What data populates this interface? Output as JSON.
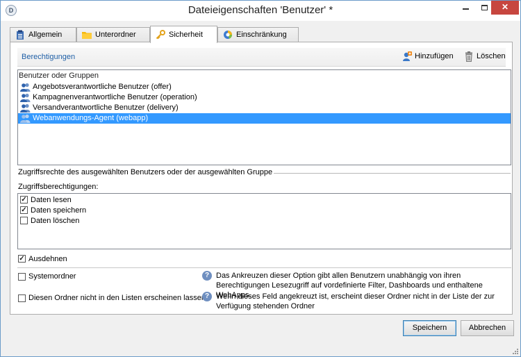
{
  "window": {
    "title": "Dateieigenschaften 'Benutzer' *",
    "app_icon": "D",
    "controls": {
      "minimize": "minimize-icon",
      "maximize": "maximize-icon",
      "close": "✕"
    }
  },
  "tabs": [
    {
      "label": "Allgemein",
      "icon": "clipboard-icon",
      "active": false
    },
    {
      "label": "Unterordner",
      "icon": "folder-icon",
      "active": false
    },
    {
      "label": "Sicherheit",
      "icon": "key-icon",
      "active": true
    },
    {
      "label": "Einschränkung",
      "icon": "pie-icon",
      "active": false
    }
  ],
  "permissions": {
    "title": "Berechtigungen",
    "add_label": "Hinzufügen",
    "delete_label": "Löschen"
  },
  "user_list": {
    "header": "Benutzer oder Gruppen",
    "items": [
      {
        "label": "Angebotsverantwortliche Benutzer (offer)",
        "selected": false
      },
      {
        "label": "Kampagnenverantwortliche Benutzer (operation)",
        "selected": false
      },
      {
        "label": "Versandverantwortliche Benutzer (delivery)",
        "selected": false
      },
      {
        "label": "Webanwendungs-Agent (webapp)",
        "selected": true
      }
    ]
  },
  "rights": {
    "section_label": "Zugriffsrechte des ausgewählten Benutzers oder der ausgewählten Gruppe",
    "list_label": "Zugriffsberechtigungen:",
    "items": [
      {
        "label": "Daten lesen",
        "checked": true
      },
      {
        "label": "Daten speichern",
        "checked": true
      },
      {
        "label": "Daten löschen",
        "checked": false
      }
    ],
    "extend_label": "Ausdehnen",
    "extend_checked": true
  },
  "options": [
    {
      "label": "Systemordner",
      "checked": false,
      "help": "Das Ankreuzen dieser Option gibt allen Benutzern unabhängig von ihren Berechtigungen Lesezugriff auf vordefinierte Filter, Dashboards und enthaltene WebApps."
    },
    {
      "label": "Diesen Ordner nicht in den Listen erscheinen lassen",
      "checked": false,
      "help": "Wenn dieses Feld angekreuzt ist, erscheint dieser Ordner nicht in der Liste der zur Verfügung stehenden Ordner"
    }
  ],
  "buttons": {
    "save": "Speichern",
    "cancel": "Abbrechen"
  },
  "colors": {
    "selection": "#3399ff",
    "link": "#1f5fa6",
    "close": "#c7463f"
  }
}
